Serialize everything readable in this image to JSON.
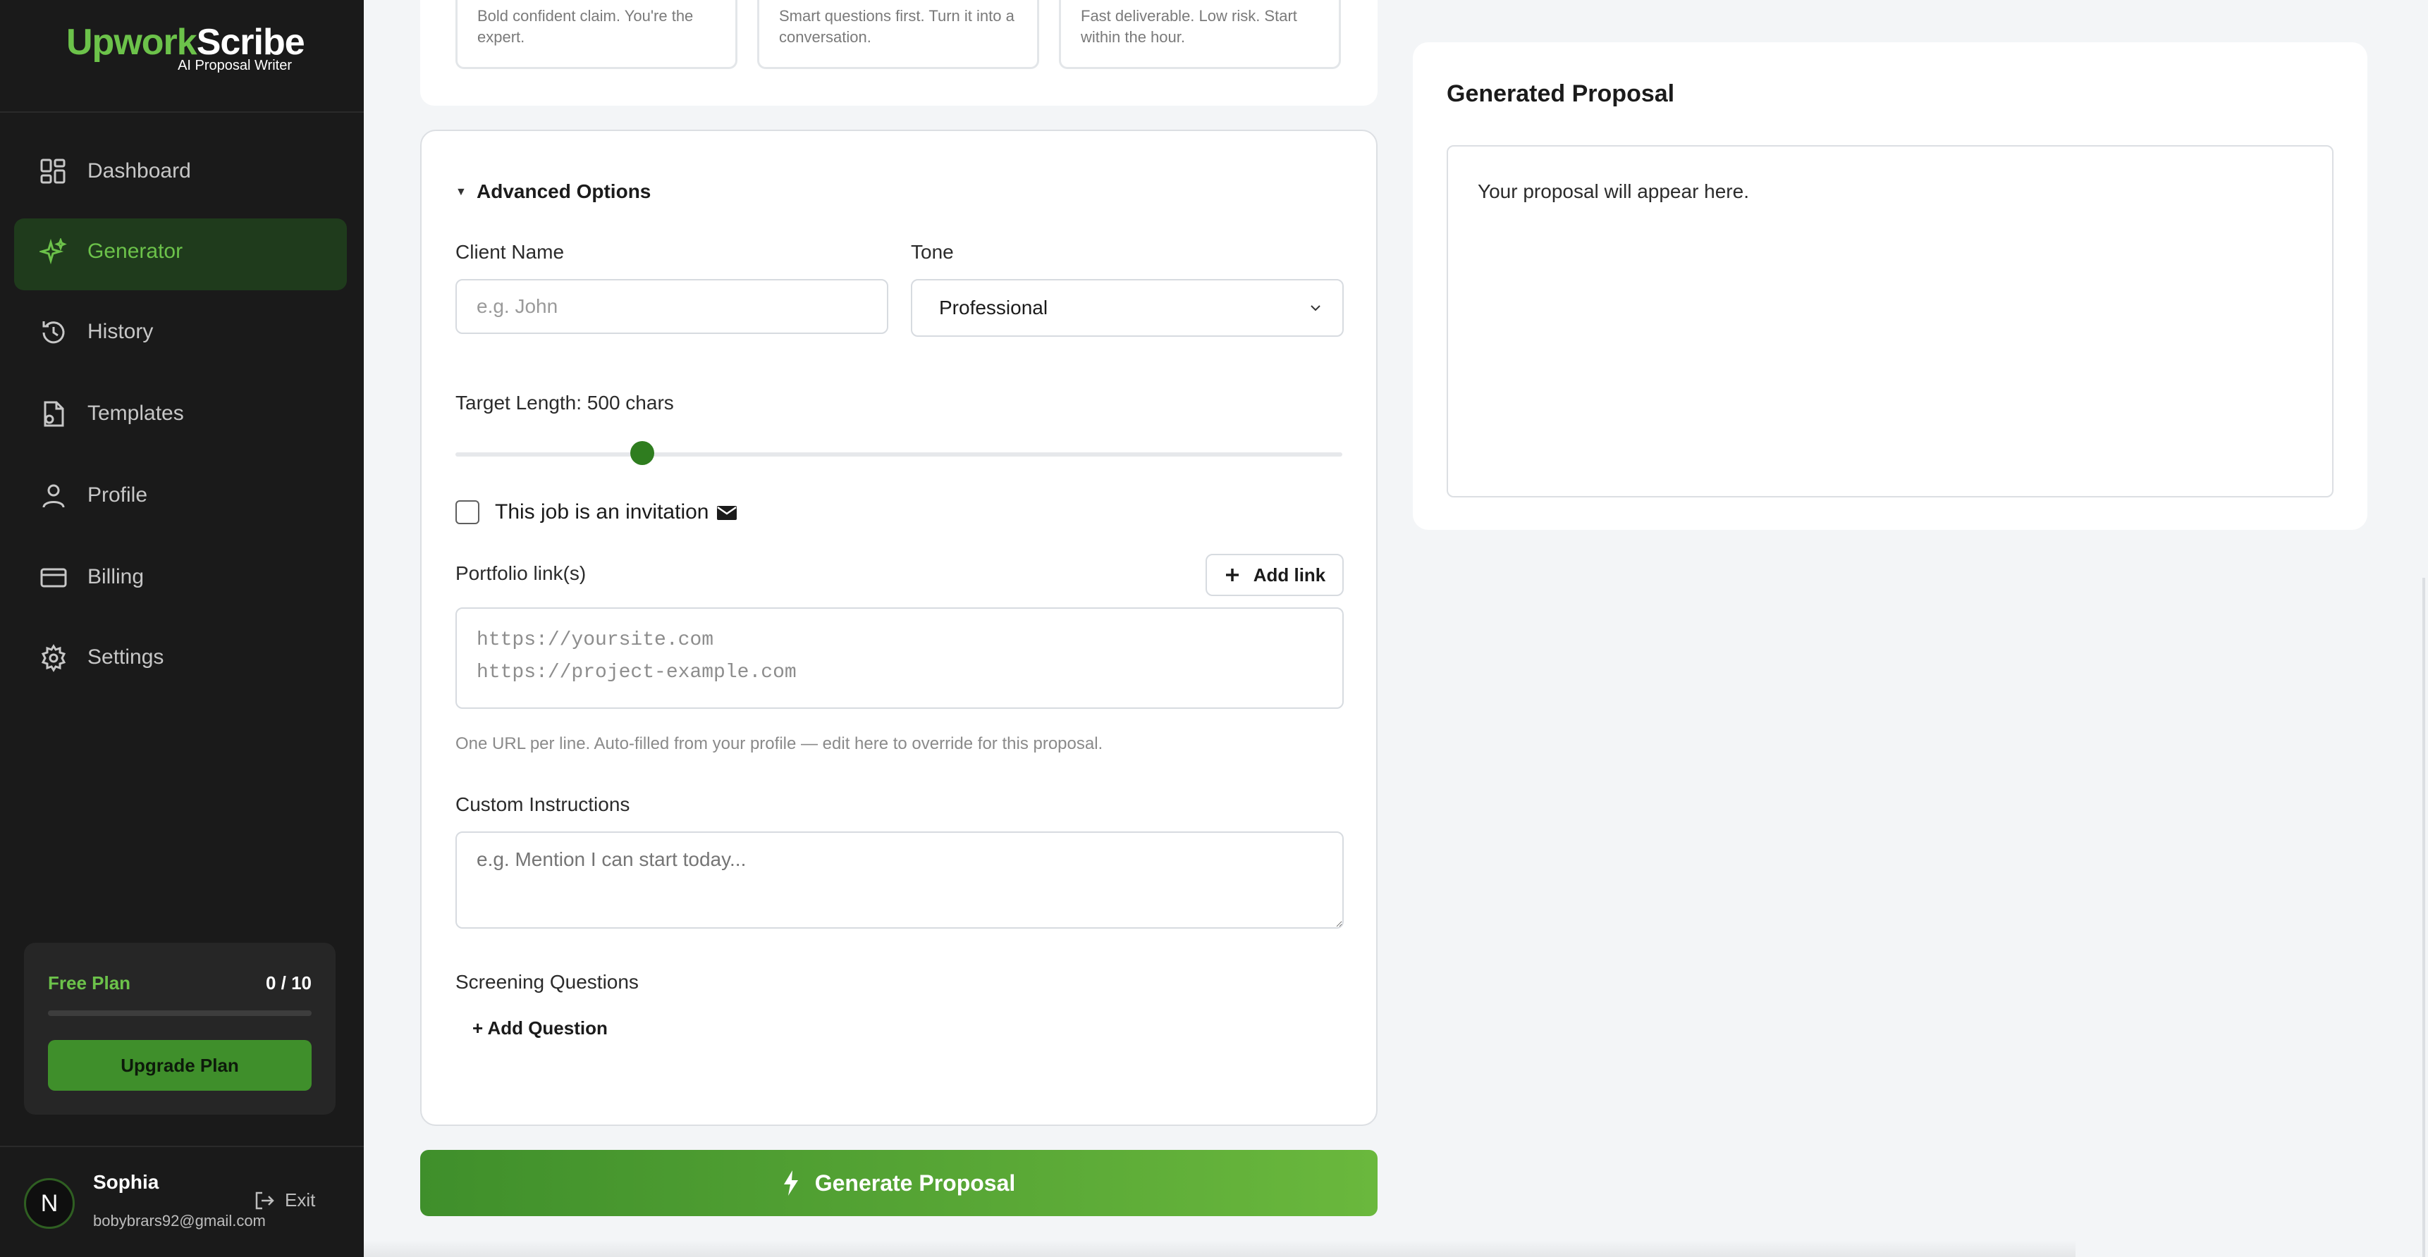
{
  "brand": {
    "name_part1": "Upwork",
    "name_part2": "Scribe",
    "tagline": "AI Proposal Writer"
  },
  "sidebar": {
    "items": [
      {
        "label": "Dashboard",
        "icon": "dashboard-icon"
      },
      {
        "label": "Generator",
        "icon": "sparkle-icon",
        "active": true
      },
      {
        "label": "History",
        "icon": "history-icon"
      },
      {
        "label": "Templates",
        "icon": "templates-icon"
      },
      {
        "label": "Profile",
        "icon": "user-icon"
      },
      {
        "label": "Billing",
        "icon": "card-icon"
      },
      {
        "label": "Settings",
        "icon": "gear-icon"
      }
    ],
    "plan": {
      "name": "Free Plan",
      "usage": "0 / 10",
      "usage_fraction": 0,
      "upgrade_label": "Upgrade Plan"
    },
    "user": {
      "initial": "N",
      "name": "Sophia",
      "email": "bobybrars92@gmail.com",
      "exit_label": "Exit"
    }
  },
  "tone_cards": [
    {
      "desc": "Bold confident claim. You're the expert."
    },
    {
      "desc": "Smart questions first. Turn it into a conversation."
    },
    {
      "desc": "Fast deliverable. Low risk. Start within the hour."
    }
  ],
  "advanced": {
    "caret": "▼",
    "title": "Advanced Options",
    "client_name": {
      "label": "Client Name",
      "placeholder": "e.g. John",
      "value": ""
    },
    "tone": {
      "label": "Tone",
      "value": "Professional"
    },
    "target_length": {
      "label": "Target Length: 500 chars",
      "value": 500,
      "min": 100,
      "max": 2000
    },
    "invitation": {
      "label": "This job is an invitation",
      "checked": false
    },
    "portfolio": {
      "label": "Portfolio link(s)",
      "add_label": "Add link",
      "placeholder_line1": "https://yoursite.com",
      "placeholder_line2": "https://project-example.com",
      "help": "One URL per line. Auto-filled from your profile — edit here to override for this proposal."
    },
    "custom_instructions": {
      "label": "Custom Instructions",
      "placeholder": "e.g. Mention I can start today..."
    },
    "screening": {
      "label": "Screening Questions",
      "add_label": "+ Add Question"
    }
  },
  "generate_label": "Generate Proposal",
  "proposal": {
    "title": "Generated Proposal",
    "placeholder": "Your proposal will appear here."
  },
  "colors": {
    "accent": "#6cc24a",
    "accent_dark": "#3f8f2b",
    "sidebar_bg": "#1a1a1a"
  }
}
